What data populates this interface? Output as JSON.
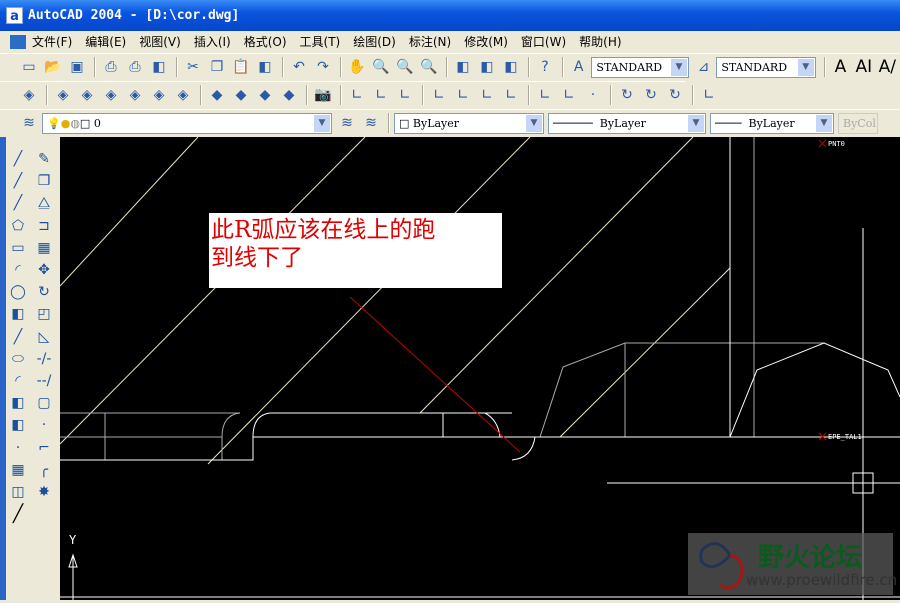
{
  "window": {
    "title": "AutoCAD 2004 - [D:\\cor.dwg]",
    "app_icon": "a"
  },
  "menu": [
    "文件(F)",
    "编辑(E)",
    "视图(V)",
    "插入(I)",
    "格式(O)",
    "工具(T)",
    "绘图(D)",
    "标注(N)",
    "修改(M)",
    "窗口(W)",
    "帮助(H)"
  ],
  "toolbar1": {
    "icons": [
      "new-icon",
      "open-icon",
      "save-icon",
      "print-icon",
      "print-preview-icon",
      "publish-icon",
      "cut-icon",
      "copy-icon",
      "paste-icon",
      "match-properties-icon",
      "undo-icon",
      "redo-icon",
      "pan-icon",
      "zoom-realtime-icon",
      "zoom-window-icon",
      "zoom-previous-icon",
      "design-center-icon",
      "properties-icon",
      "tool-palettes-icon",
      "help-icon"
    ],
    "text_style": "STANDARD",
    "dim_style": "STANDARD",
    "text_icons": [
      "A",
      "AI",
      "A/"
    ]
  },
  "toolbar2": {
    "icons": [
      "named-views-icon",
      "top-view-icon",
      "bottom-view-icon",
      "left-view-icon",
      "right-view-icon",
      "front-view-icon",
      "back-view-icon",
      "sw-iso-icon",
      "se-iso-icon",
      "ne-iso-icon",
      "nw-iso-icon",
      "camera-icon",
      "ucs-icon",
      "display-ucs-icon",
      "ucs-previous-icon",
      "world-ucs-icon",
      "object-ucs-icon",
      "face-ucs-icon",
      "view-ucs-icon",
      "origin-ucs-icon",
      "zaxis-ucs-icon",
      "3point-ucs-icon",
      "x-rotate-icon",
      "y-rotate-icon",
      "z-rotate-icon",
      "apply-ucs-icon"
    ]
  },
  "layers": {
    "current_layer": "0",
    "color": "ByLayer",
    "linetype": "ByLayer",
    "lineweight": "ByLayer",
    "plotstyle": "ByCol"
  },
  "draw_tools": [
    "line-icon",
    "construction-line-icon",
    "polyline-icon",
    "polygon-icon",
    "rectangle-icon",
    "arc-icon",
    "circle-icon",
    "revision-cloud-icon",
    "spline-icon",
    "ellipse-icon",
    "ellipse-arc-icon",
    "insert-block-icon",
    "make-block-icon",
    "point-icon",
    "hatch-icon",
    "region-icon",
    "multiline-text-icon"
  ],
  "modify_tools": [
    "erase-icon",
    "copy-object-icon",
    "mirror-icon",
    "offset-icon",
    "array-icon",
    "move-icon",
    "rotate-icon",
    "scale-icon",
    "stretch-icon",
    "trim-icon",
    "extend-icon",
    "break-icon",
    "break-at-point-icon",
    "chamfer-icon",
    "fillet-icon",
    "explode-icon"
  ],
  "drawing": {
    "annotation": [
      "此R弧应该在线上的跑",
      "到线下了"
    ],
    "point_labels": [
      "PNT0",
      "EPE_TAL1"
    ],
    "ucs_label": "Y",
    "annotation_color": "#e00000",
    "leader_color": "#cc0000"
  },
  "watermark": {
    "text": "野火论坛",
    "url": "www.proewildfire.cn"
  }
}
